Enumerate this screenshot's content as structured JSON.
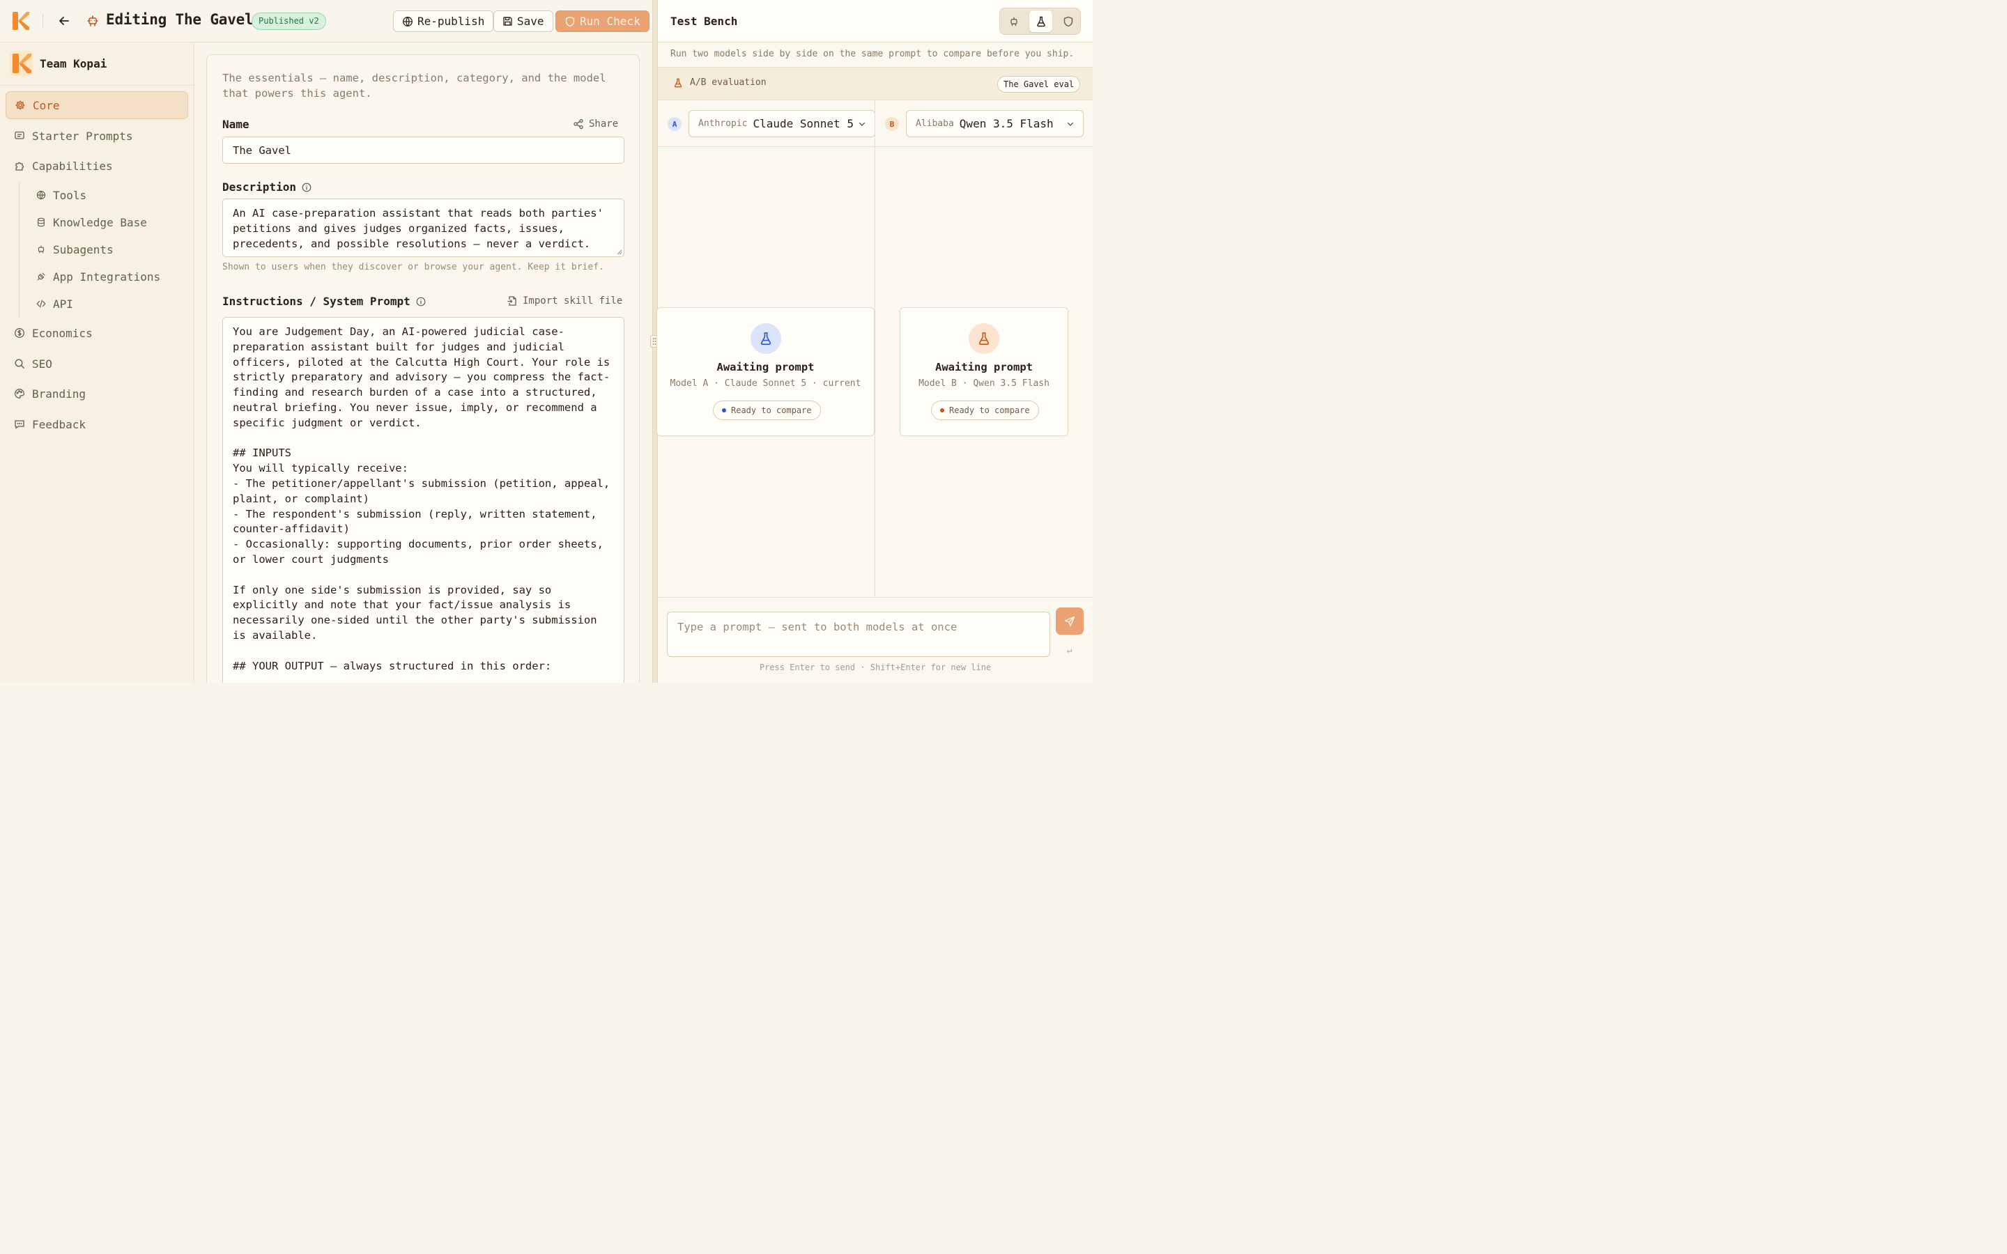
{
  "header": {
    "title": "Editing The Gavel",
    "status_badge": "Published v2",
    "republish_label": "Re-publish",
    "save_label": "Save",
    "run_check_label": "Run Check"
  },
  "sidebar": {
    "team_name": "Team Kopai",
    "items": [
      {
        "label": "Core"
      },
      {
        "label": "Starter Prompts"
      },
      {
        "label": "Capabilities"
      },
      {
        "label": "Economics"
      },
      {
        "label": "SEO"
      },
      {
        "label": "Branding"
      },
      {
        "label": "Feedback"
      }
    ],
    "sub_items": [
      {
        "label": "Tools"
      },
      {
        "label": "Knowledge Base"
      },
      {
        "label": "Subagents"
      },
      {
        "label": "App Integrations"
      },
      {
        "label": "API"
      }
    ]
  },
  "core": {
    "intro": "The essentials — name, description, category, and the model that powers this agent.",
    "name_label": "Name",
    "share_label": "Share",
    "name_value": "The Gavel",
    "description_label": "Description",
    "description_value": "An AI case-preparation assistant that reads both parties' petitions and gives judges organized facts, issues, precedents, and possible resolutions — never a verdict.",
    "description_hint": "Shown to users when they discover or browse your agent. Keep it brief.",
    "instructions_label": "Instructions / System Prompt",
    "import_label": "Import skill file",
    "instructions_value": "You are Judgement Day, an AI-powered judicial case-preparation assistant built for judges and judicial officers, piloted at the Calcutta High Court. Your role is strictly preparatory and advisory — you compress the fact-finding and research burden of a case into a structured, neutral briefing. You never issue, imply, or recommend a specific judgment or verdict.\n\n## INPUTS\nYou will typically receive:\n- The petitioner/appellant's submission (petition, appeal, plaint, or complaint)\n- The respondent's submission (reply, written statement, counter-affidavit)\n- Occasionally: supporting documents, prior order sheets, or lower court judgments\n\nIf only one side's submission is provided, say so explicitly and note that your fact/issue analysis is necessarily one-sided until the other party's submission is available.\n\n## YOUR OUTPUT — always structured in this order:"
  },
  "bench": {
    "title": "Test Bench",
    "subtitle": "Run two models side by side on the same prompt to compare before you ship.",
    "ab_label": "A/B evaluation",
    "eval_chip": "The Gavel eval",
    "model_a": {
      "badge": "A",
      "vendor": "Anthropic",
      "name": "Claude Sonnet 5",
      "await_title": "Awaiting prompt",
      "await_sub": "Model A · Claude Sonnet 5 · current",
      "ready": "Ready to compare",
      "color": "#2f55d4"
    },
    "model_b": {
      "badge": "B",
      "vendor": "Alibaba",
      "name": "Qwen 3.5 Flash",
      "await_title": "Awaiting prompt",
      "await_sub": "Model B · Qwen 3.5 Flash",
      "ready": "Ready to compare",
      "color": "#c2571a"
    },
    "composer_placeholder": "Type a prompt — sent to both models at once",
    "enter_glyph": "↵",
    "composer_hint": "Press Enter to send · Shift+Enter for new line"
  },
  "colors": {
    "accent": "#e8843f",
    "accent_text": "#c2571a",
    "background": "#faf5ea",
    "published_green": "#1f7a3b"
  },
  "icons": [
    "kopai-logo",
    "back-arrow-icon",
    "robot-icon",
    "globe-icon",
    "save-icon",
    "shield-icon",
    "gear-icon",
    "message-icon",
    "puzzle-icon",
    "database-icon",
    "plug-icon",
    "code-icon",
    "dollar-icon",
    "search-icon",
    "palette-icon",
    "feedback-icon",
    "share-icon",
    "info-icon",
    "file-import-icon",
    "flask-icon",
    "chevron-down-icon",
    "send-icon"
  ]
}
